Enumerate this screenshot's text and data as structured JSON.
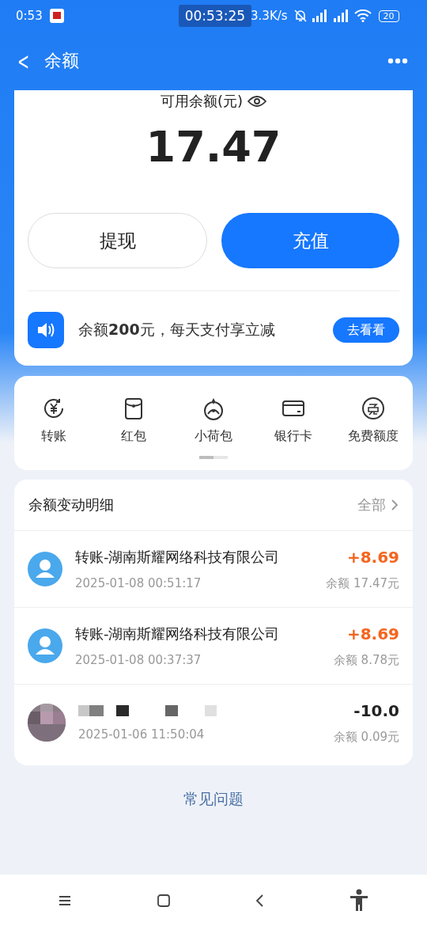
{
  "status_bar": {
    "time": "0:53",
    "recording_timer": "00:53:25",
    "net_speed": "3.3K/s",
    "battery": "20"
  },
  "header": {
    "back": "<",
    "title": "余额"
  },
  "balance": {
    "label": "可用余额(元)",
    "amount": "17.47"
  },
  "actions": [
    {
      "label": "提现",
      "kind": "outline"
    },
    {
      "label": "充值",
      "kind": "primary"
    }
  ],
  "promo": {
    "text": "余额**200**元，每天支付享立减",
    "button": "去看看"
  },
  "shortcuts": {
    "items": [
      {
        "label": "转账",
        "kind": "transfer"
      },
      {
        "label": "红包",
        "kind": "envelope"
      },
      {
        "label": "小荷包",
        "kind": "pouch"
      },
      {
        "label": "银行卡",
        "kind": "card"
      },
      {
        "label": "免费额度",
        "kind": "free"
      }
    ],
    "pager": [
      {
        "selected": true
      },
      {
        "selected": false
      }
    ]
  },
  "history": {
    "title": "余额变动明细",
    "all": "全部",
    "rows": [
      {
        "kind": "person",
        "title": "转账-湖南斯耀网络科技有限公司",
        "time": "2025-01-08 00:51:17",
        "amount": "+8.69",
        "income": true,
        "balance": "余额 17.47元"
      },
      {
        "kind": "person",
        "title": "转账-湖南斯耀网络科技有限公司",
        "time": "2025-01-08 00:37:37",
        "amount": "+8.69",
        "income": true,
        "balance": "余额 8.78元"
      },
      {
        "kind": "redacted",
        "time": "2025-01-06 11:50:04",
        "amount": "-10.0",
        "income": false,
        "balance": "余额 0.09元"
      }
    ]
  },
  "faq": "常见问题"
}
